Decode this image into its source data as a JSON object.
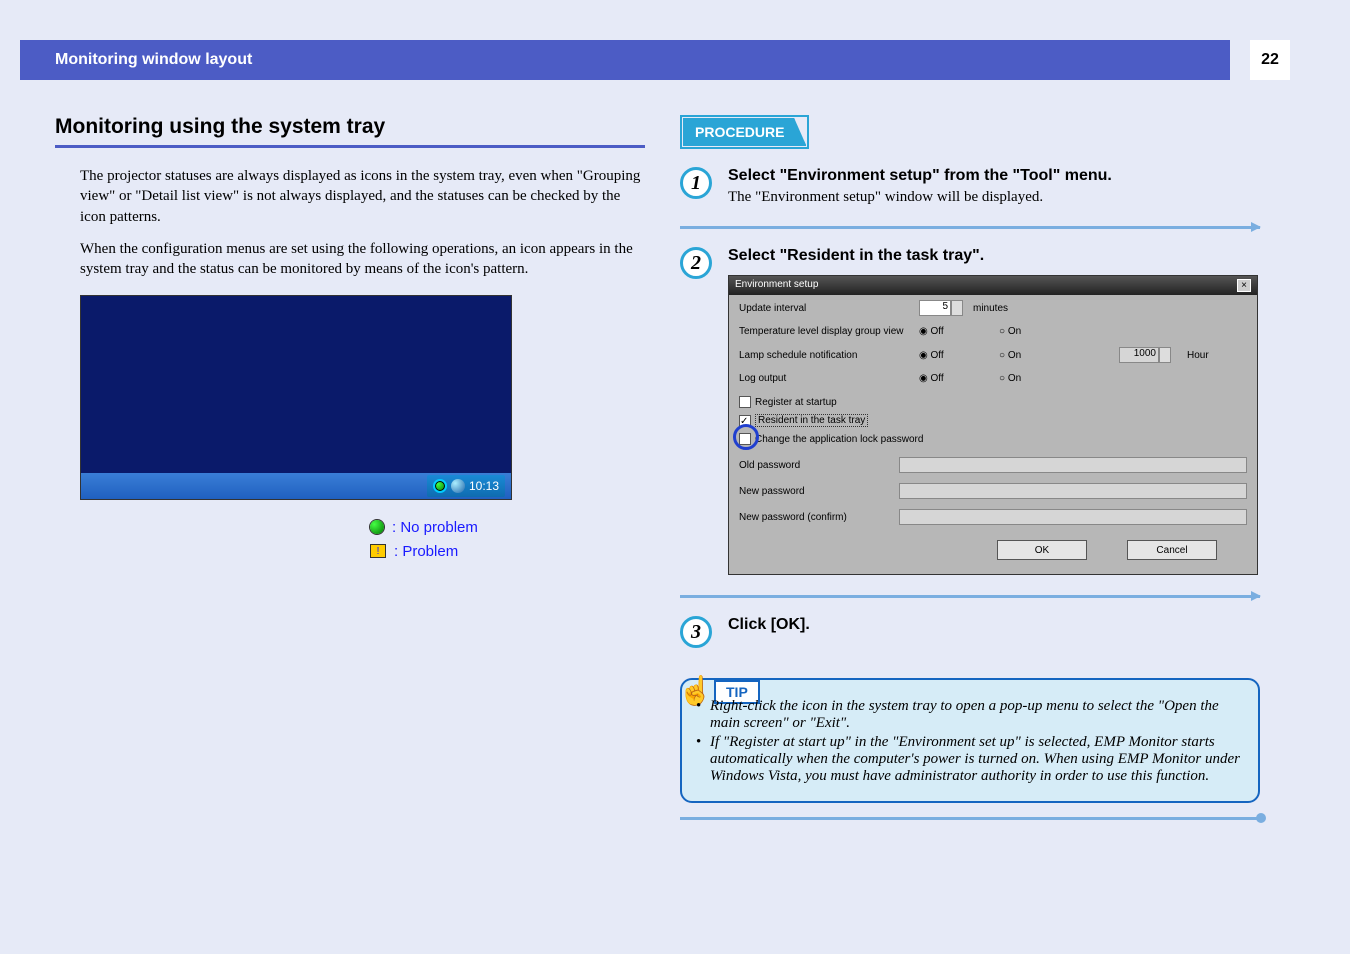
{
  "header": {
    "title": "Monitoring window layout",
    "page_number": "22"
  },
  "left": {
    "section_title": "Monitoring using the system tray",
    "para1": "The projector statuses are always displayed as icons in the system tray, even when \"Grouping view\" or \"Detail list view\" is not always displayed, and the statuses can be checked by the icon patterns.",
    "para2": "When the configuration menus are set using the following operations, an icon appears in the system tray and the status can be monitored by means of the icon's pattern.",
    "tray_time": "10:13",
    "legend_ok": ": No problem",
    "legend_problem": ": Problem"
  },
  "procedure": {
    "label": "PROCEDURE",
    "step1_title": "Select \"Environment setup\" from the \"Tool\" menu.",
    "step1_desc": "The \"Environment setup\" window will be displayed.",
    "step2_title": "Select \"Resident in the task tray\".",
    "step3_title": "Click [OK]."
  },
  "env": {
    "title": "Environment setup",
    "update_interval": "Update interval",
    "update_value": "5",
    "minutes": "minutes",
    "temp_row": "Temperature level display group view",
    "lamp_row": "Lamp schedule notification",
    "log_row": "Log output",
    "off": "Off",
    "on": "On",
    "hour_value": "1000",
    "hour": "Hour",
    "register": "Register at startup",
    "resident": "Resident in the task tray",
    "change_pw": "Change the application lock password",
    "old_pw": "Old password",
    "new_pw": "New password",
    "confirm_pw": "New password (confirm)",
    "ok": "OK",
    "cancel": "Cancel"
  },
  "tip": {
    "label": "TIP",
    "item1": "Right-click the icon in the system tray to open a pop-up menu to select the \"Open the main screen\" or \"Exit\".",
    "item2": "If \"Register at start up\" in the \"Environment set up\" is selected, EMP Monitor starts automatically when the computer's power is turned on. When using EMP Monitor under Windows Vista, you must have administrator authority in order to use this function."
  }
}
